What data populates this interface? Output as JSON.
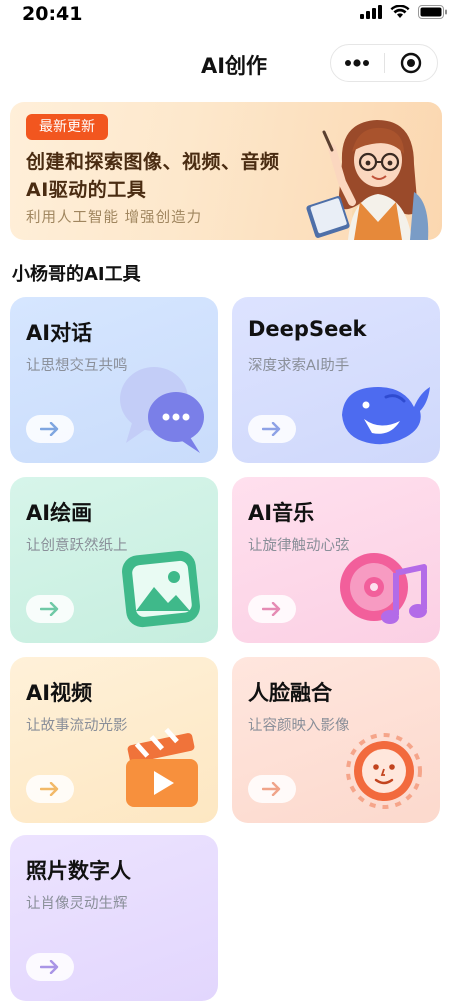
{
  "status_bar": {
    "time": "20:41"
  },
  "nav": {
    "title": "AI创作",
    "more_icon": "more-dots-icon",
    "close_icon": "target-close-icon"
  },
  "banner": {
    "badge": "最新更新",
    "headline_line1": "创建和探索图像、视频、音频",
    "headline_line2": "AI驱动的工具",
    "subtitle": "利用人工智能 增强创造力"
  },
  "section_title": "小杨哥的AI工具",
  "tools": [
    {
      "title": "AI对话",
      "subtitle": "让思想交互共鸣",
      "icon": "chat-bubbles-icon",
      "bg_from": "#d6e6ff",
      "bg_to": "#c9dcfb",
      "arrow": "#7fa6e0"
    },
    {
      "title": "DeepSeek",
      "subtitle": "深度求索AI助手",
      "icon": "whale-icon",
      "bg_from": "#dde3ff",
      "bg_to": "#cfd8fb",
      "arrow": "#8ea2e6"
    },
    {
      "title": "AI绘画",
      "subtitle": "让创意跃然纸上",
      "icon": "image-picture-icon",
      "bg_from": "#d7f5ea",
      "bg_to": "#c6eedf",
      "arrow": "#6fc9a6"
    },
    {
      "title": "AI音乐",
      "subtitle": "让旋律触动心弦",
      "icon": "music-disc-icon",
      "bg_from": "#ffe0ee",
      "bg_to": "#fbd0e4",
      "arrow": "#e58bb4"
    },
    {
      "title": "AI视频",
      "subtitle": "让故事流动光影",
      "icon": "clapperboard-play-icon",
      "bg_from": "#fff1d9",
      "bg_to": "#fde7c2",
      "arrow": "#f2b968"
    },
    {
      "title": "人脸融合",
      "subtitle": "让容颜映入影像",
      "icon": "face-icon",
      "bg_from": "#ffe6de",
      "bg_to": "#fcd9cd",
      "arrow": "#f0a48a"
    },
    {
      "title": "照片数字人",
      "subtitle": "让肖像灵动生辉",
      "icon": "digital-human-icon",
      "bg_from": "#ece3ff",
      "bg_to": "#e2d6fd",
      "arrow": "#a995e6"
    }
  ]
}
